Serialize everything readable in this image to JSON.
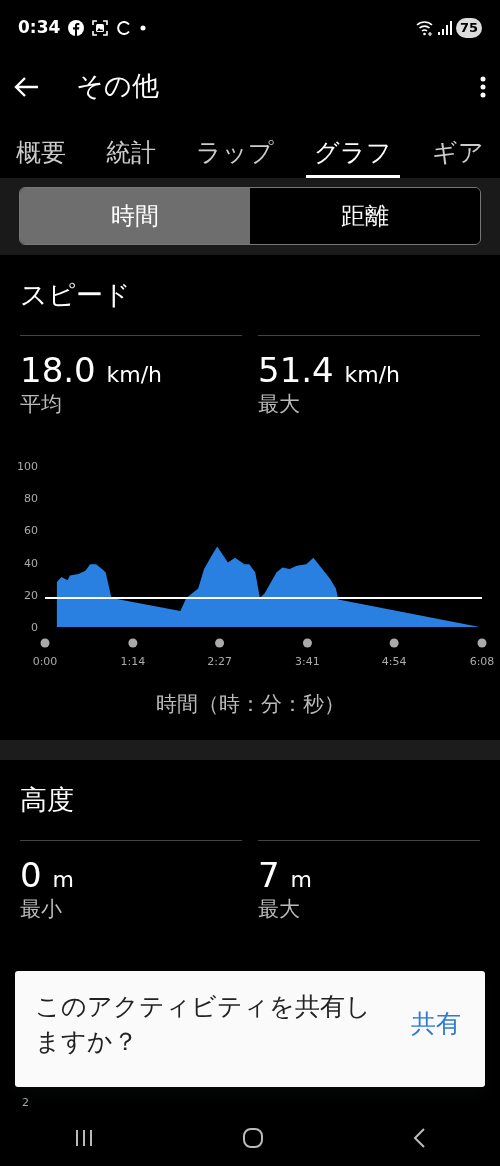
{
  "status_bar": {
    "time": "0:34",
    "battery": "75"
  },
  "header": {
    "title": "その他"
  },
  "tabs": [
    {
      "label": "概要",
      "selected": false
    },
    {
      "label": "統計",
      "selected": false
    },
    {
      "label": "ラップ",
      "selected": false
    },
    {
      "label": "グラフ",
      "selected": true
    },
    {
      "label": "ギア",
      "selected": false
    }
  ],
  "segments": [
    {
      "label": "時間",
      "selected": true
    },
    {
      "label": "距離",
      "selected": false
    }
  ],
  "speed": {
    "title": "スピード",
    "stats": [
      {
        "value": "18.0",
        "unit": "km/h",
        "label": "平均"
      },
      {
        "value": "51.4",
        "unit": "km/h",
        "label": "最大"
      }
    ],
    "chart_data": {
      "type": "area",
      "xlabel": "時間（時：分：秒）",
      "xlim": [
        0,
        368
      ],
      "ylim": [
        0,
        100
      ],
      "yticks": [
        0,
        20,
        40,
        60,
        80,
        100
      ],
      "xticks": [
        {
          "value": 0,
          "label": "0:00"
        },
        {
          "value": 74,
          "label": "1:14"
        },
        {
          "value": 147,
          "label": "2:27"
        },
        {
          "value": 221,
          "label": "3:41"
        },
        {
          "value": 294,
          "label": "4:54"
        },
        {
          "value": 368,
          "label": "6:08"
        }
      ],
      "x": [
        10,
        14,
        19,
        21,
        28,
        34,
        38,
        43,
        48,
        51,
        56,
        114,
        119,
        129,
        134,
        140,
        145,
        154,
        160,
        168,
        172,
        174,
        177,
        181,
        185,
        195,
        200,
        206,
        212,
        220,
        226,
        240,
        245,
        247,
        366
      ],
      "series": [
        {
          "color": "#2a80e0",
          "values": [
            28,
            31,
            29,
            32,
            33,
            35,
            39,
            39,
            36,
            34,
            18,
            10,
            18,
            24,
            36,
            44,
            50,
            40,
            43,
            39,
            39,
            37,
            34,
            18,
            21,
            34,
            37,
            36,
            38,
            39,
            43,
            30,
            24,
            17,
            0
          ]
        }
      ]
    }
  },
  "altitude": {
    "title": "高度",
    "stats": [
      {
        "value": "0",
        "unit": "m",
        "label": "最小"
      },
      {
        "value": "7",
        "unit": "m",
        "label": "最大"
      }
    ],
    "chart_ticks": [
      "2"
    ]
  },
  "dialog": {
    "message": "このアクティビティを共有しますか？",
    "action": "共有"
  }
}
